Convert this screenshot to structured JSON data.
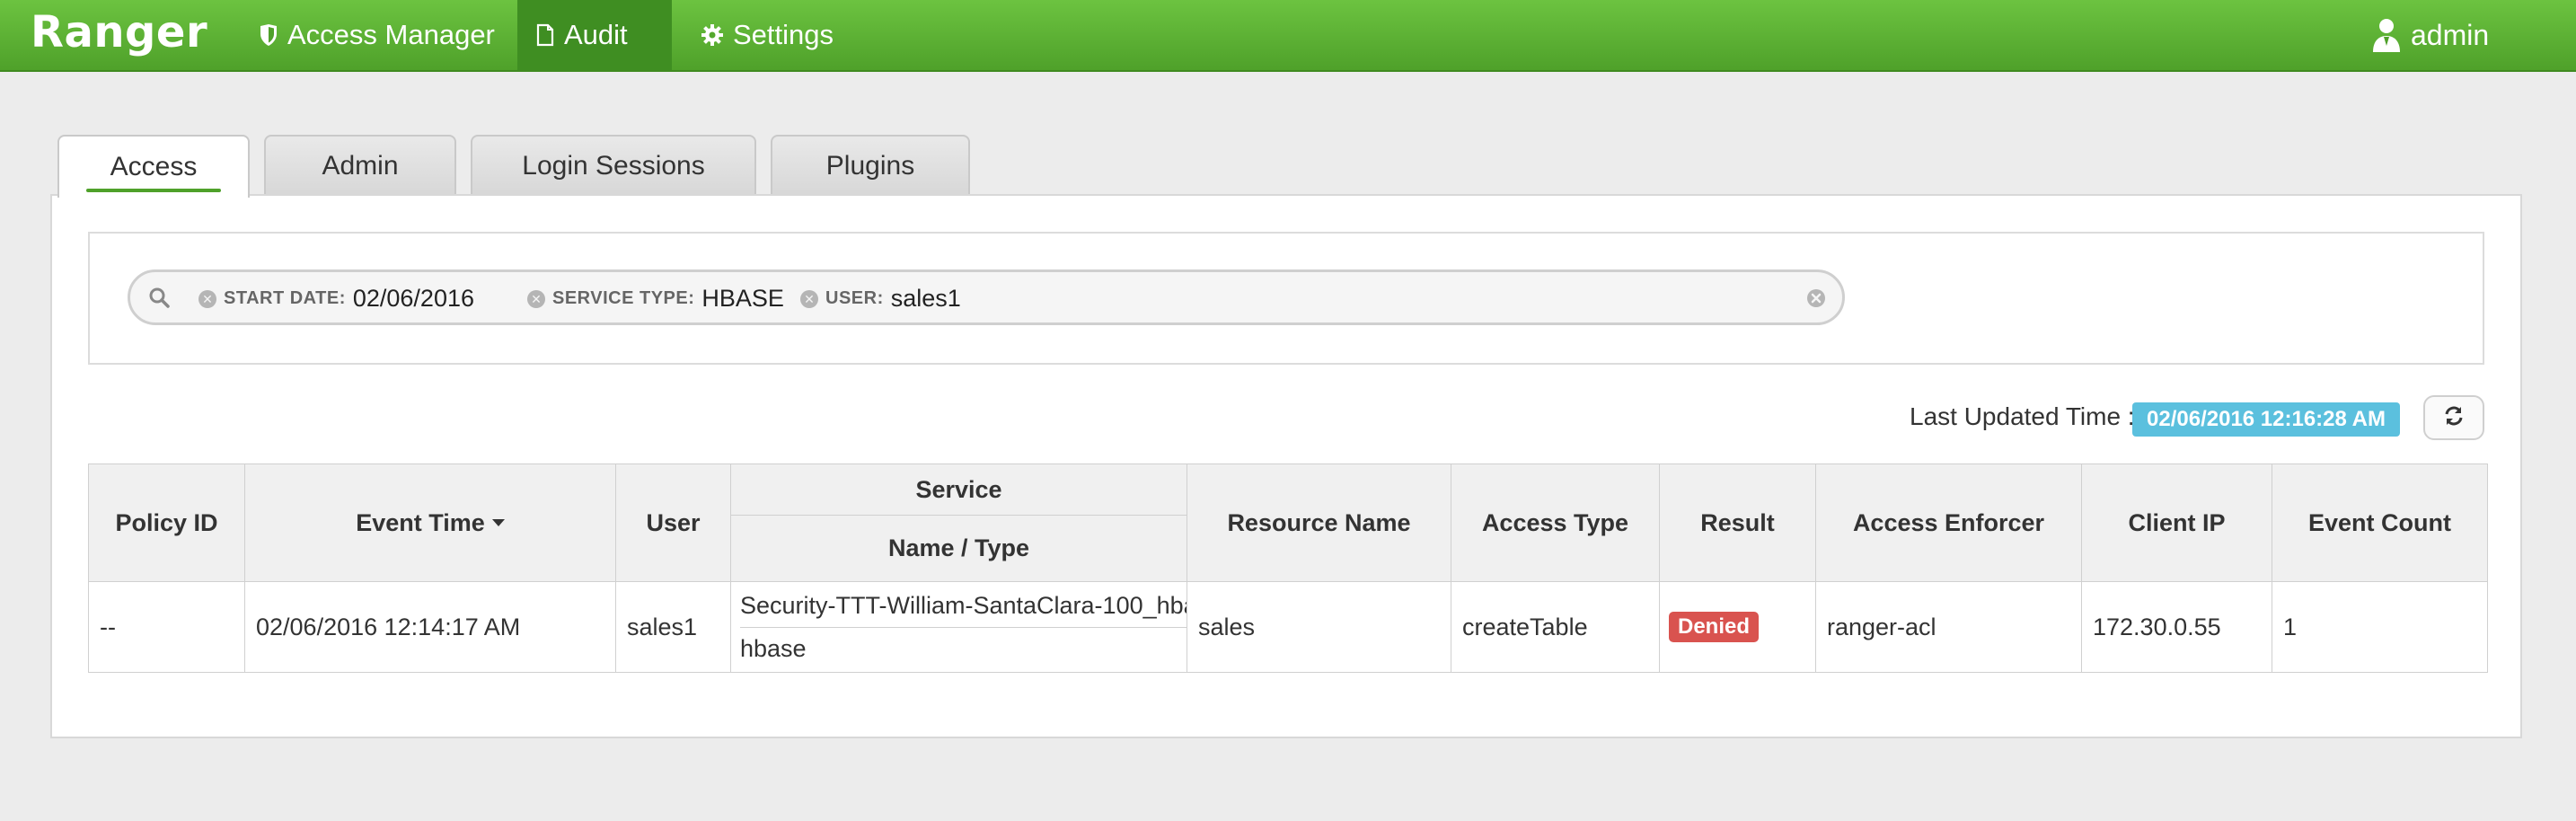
{
  "navbar": {
    "brand": "Ranger",
    "items": [
      {
        "label": "Access Manager",
        "icon": "shield-icon",
        "active": false
      },
      {
        "label": "Audit",
        "icon": "document-icon",
        "active": true
      },
      {
        "label": "Settings",
        "icon": "gear-icon",
        "active": false
      }
    ],
    "user": {
      "label": "admin",
      "icon": "user-icon"
    },
    "color": "#5bb336",
    "active_color": "#3f8e22"
  },
  "tabs": [
    {
      "label": "Access",
      "active": true
    },
    {
      "label": "Admin",
      "active": false
    },
    {
      "label": "Login Sessions",
      "active": false
    },
    {
      "label": "Plugins",
      "active": false
    }
  ],
  "search": {
    "icon": "search-icon",
    "facets": [
      {
        "category": "START DATE:",
        "value": "02/06/2016"
      },
      {
        "category": "SERVICE TYPE:",
        "value": "HBASE"
      },
      {
        "category": "USER:",
        "value": "sales1"
      }
    ],
    "clear_icon": "clear-icon"
  },
  "last_updated": {
    "label": "Last Updated Time :",
    "value": "02/06/2016 12:16:28 AM",
    "color": "#5bc0de"
  },
  "refresh_icon": "refresh-icon",
  "table": {
    "headers": {
      "policy_id": "Policy ID",
      "event_time": "Event Time",
      "user": "User",
      "service_group": "Service",
      "service_name_type": "Name / Type",
      "resource_name": "Resource Name",
      "access_type": "Access Type",
      "result": "Result",
      "access_enforcer": "Access Enforcer",
      "client_ip": "Client IP",
      "event_count": "Event Count"
    },
    "sorted_column": "event_time",
    "rows": [
      {
        "policy_id": "--",
        "event_time": "02/06/2016 12:14:17 AM",
        "user": "sales1",
        "service_name": "Security-TTT-William-SantaClara-100_hba",
        "service_type": "hbase",
        "resource_name": "sales",
        "access_type": "createTable",
        "result": "Denied",
        "result_color": "#d9534f",
        "access_enforcer": "ranger-acl",
        "client_ip": "172.30.0.55",
        "event_count": "1"
      }
    ]
  }
}
